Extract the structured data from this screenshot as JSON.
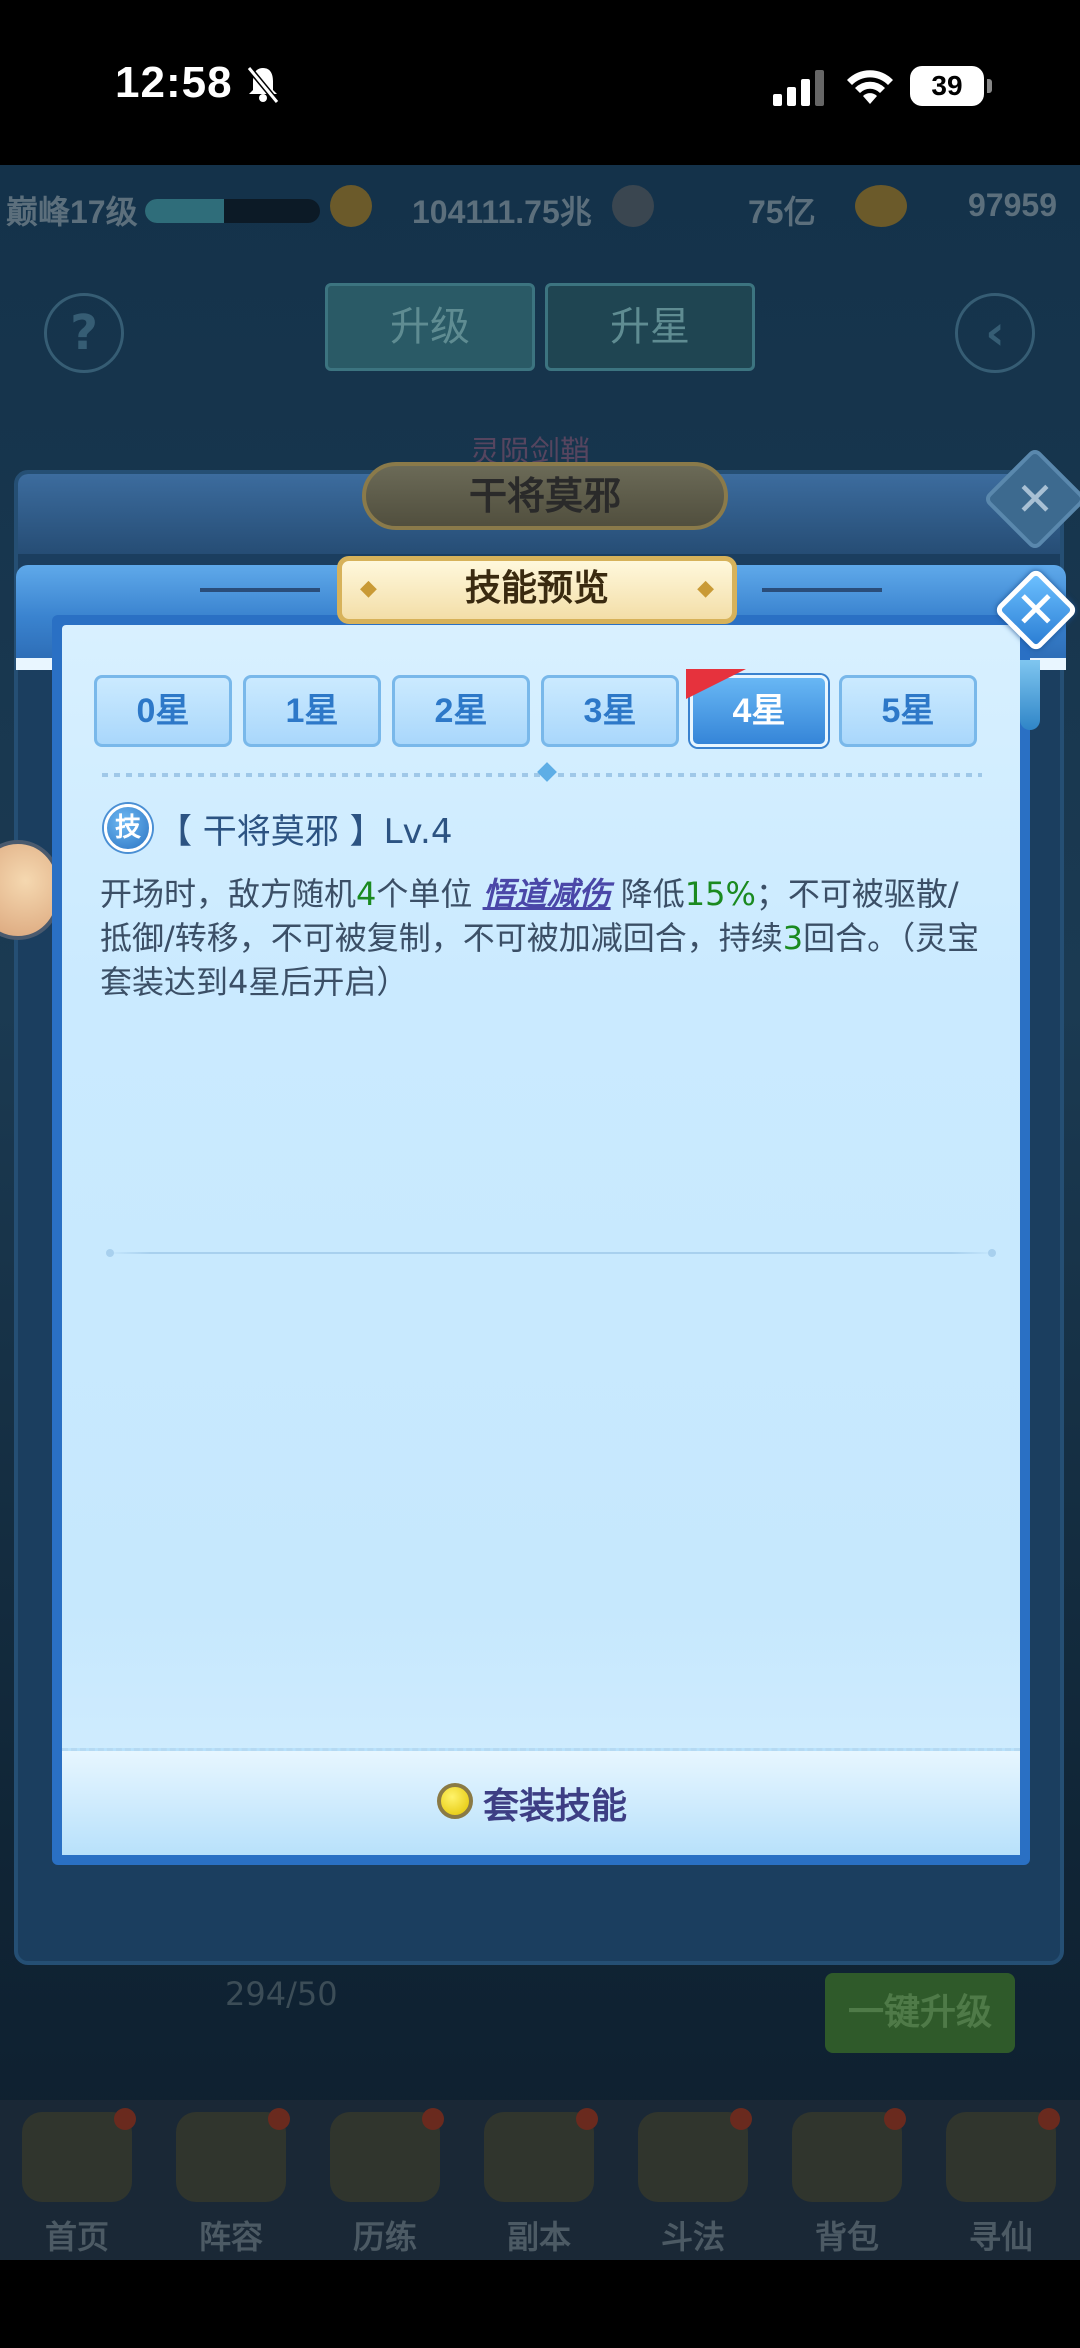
{
  "status_bar": {
    "time": "12:58",
    "battery": "39"
  },
  "background": {
    "level_label": "巅峰17级",
    "level_progress": 0.45,
    "currency_1": "104111.75兆",
    "currency_2": "75亿",
    "currency_3": "97959",
    "tab_upgrade": "升级",
    "tab_star": "升星",
    "subtitle": "灵陨剑鞘",
    "progress_text": "294/50",
    "one_key_upgrade": "一键升级",
    "nav": [
      {
        "label": "首页"
      },
      {
        "label": "阵容"
      },
      {
        "label": "历练"
      },
      {
        "label": "副本"
      },
      {
        "label": "斗法"
      },
      {
        "label": "背包"
      },
      {
        "label": "寻仙"
      }
    ]
  },
  "back_dialog": {
    "title": "干将莫邪"
  },
  "dialog": {
    "title": "技能预览",
    "tabs": [
      {
        "label": "0星"
      },
      {
        "label": "1星"
      },
      {
        "label": "2星"
      },
      {
        "label": "3星"
      },
      {
        "label": "4星"
      },
      {
        "label": "5星"
      }
    ],
    "active_tab": 4,
    "skill": {
      "badge": "技",
      "name": "【 干将莫邪 】Lv.4",
      "desc_parts": [
        {
          "text": "开场时，敌方随机",
          "style": "normal"
        },
        {
          "text": "4",
          "style": "green"
        },
        {
          "text": "个单位 ",
          "style": "normal"
        },
        {
          "text": "悟道减伤",
          "style": "link"
        },
        {
          "text": " 降低",
          "style": "normal"
        },
        {
          "text": "15%",
          "style": "green"
        },
        {
          "text": "；不可被驱散/抵御/转移，不可被复制，不可被加减回合，持续",
          "style": "normal"
        },
        {
          "text": "3",
          "style": "green"
        },
        {
          "text": "回合。（灵宝套装达到4星后开启）",
          "style": "normal"
        }
      ]
    },
    "footer_button": "套装技能"
  },
  "colors": {
    "accent_blue": "#3585d8",
    "highlight_green": "#1a8a20",
    "link_purple": "#4a47a8",
    "flag_red": "#e6323d"
  }
}
